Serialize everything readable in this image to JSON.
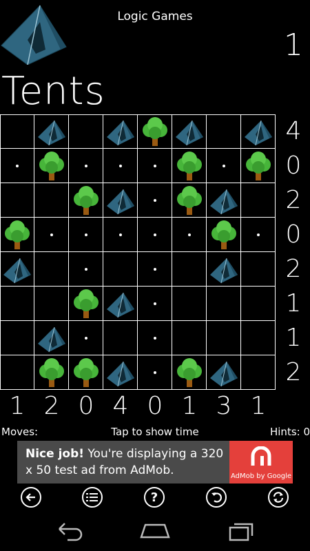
{
  "header": {
    "app_title": "Logic Games",
    "level_number": "1",
    "page_title": "Tents"
  },
  "board": {
    "rows": [
      [
        "empty",
        "tent",
        "empty",
        "tent",
        "tree",
        "tent",
        "empty",
        "tent"
      ],
      [
        "dot",
        "tree",
        "dot",
        "dot",
        "dot",
        "tree",
        "dot",
        "tree"
      ],
      [
        "empty",
        "empty",
        "tree",
        "tent",
        "dot",
        "tree",
        "tent",
        "empty"
      ],
      [
        "tree",
        "dot",
        "dot",
        "dot",
        "dot",
        "dot",
        "tree",
        "dot"
      ],
      [
        "tent",
        "empty",
        "dot",
        "empty",
        "dot",
        "empty",
        "tent",
        "empty"
      ],
      [
        "empty",
        "empty",
        "tree",
        "tent",
        "dot",
        "empty",
        "empty",
        "empty"
      ],
      [
        "empty",
        "tent",
        "dot",
        "empty",
        "dot",
        "empty",
        "empty",
        "empty"
      ],
      [
        "empty",
        "tree",
        "tree",
        "tent",
        "dot",
        "tree",
        "tent",
        "empty"
      ]
    ],
    "row_clues": [
      "4",
      "0",
      "2",
      "0",
      "2",
      "1",
      "1",
      "2"
    ],
    "col_clues": [
      "1",
      "2",
      "0",
      "4",
      "0",
      "1",
      "3",
      "1"
    ]
  },
  "status": {
    "moves_label": "Moves:",
    "tap_label": "Tap to show time",
    "hints_label": "Hints: 0"
  },
  "ad": {
    "headline": "Nice job!",
    "body": "You're displaying a 320 x 50 test ad from AdMob.",
    "brand": "AdMob by Google",
    "brand_color": "#e4403b"
  },
  "toolbar": {
    "back_icon": "arrow-left-icon",
    "menu_icon": "list-icon",
    "help_icon": "question-icon",
    "undo_icon": "undo-icon",
    "restart_icon": "refresh-icon"
  },
  "navbar": {
    "back_icon": "nav-back-icon",
    "home_icon": "nav-home-icon",
    "recents_icon": "nav-recents-icon"
  },
  "colors": {
    "background": "#000000",
    "grid_lines": "#ffffff",
    "tent_fill": "#2f6680",
    "tree_leaves": "#47b53a",
    "tree_trunk": "#9a5a12"
  }
}
